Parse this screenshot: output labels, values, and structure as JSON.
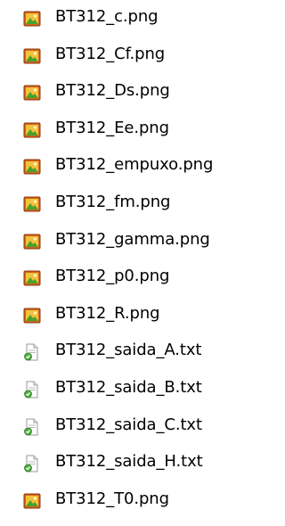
{
  "files": [
    {
      "name": "BT312_c.png",
      "icon": "png-image-icon"
    },
    {
      "name": "BT312_Cf.png",
      "icon": "png-image-icon"
    },
    {
      "name": "BT312_Ds.png",
      "icon": "png-image-icon"
    },
    {
      "name": "BT312_Ee.png",
      "icon": "png-image-icon"
    },
    {
      "name": "BT312_empuxo.png",
      "icon": "png-image-icon"
    },
    {
      "name": "BT312_fm.png",
      "icon": "png-image-icon"
    },
    {
      "name": "BT312_gamma.png",
      "icon": "png-image-icon"
    },
    {
      "name": "BT312_p0.png",
      "icon": "png-image-icon"
    },
    {
      "name": "BT312_R.png",
      "icon": "png-image-icon"
    },
    {
      "name": "BT312_saida_A.txt",
      "icon": "txt-file-icon"
    },
    {
      "name": "BT312_saida_B.txt",
      "icon": "txt-file-icon"
    },
    {
      "name": "BT312_saida_C.txt",
      "icon": "txt-file-icon"
    },
    {
      "name": "BT312_saida_H.txt",
      "icon": "txt-file-icon"
    },
    {
      "name": "BT312_T0.png",
      "icon": "png-image-icon"
    }
  ],
  "colors": {
    "text": "#000000",
    "png_icon_body": "#d4641e",
    "png_icon_accent": "#f2c23a",
    "png_icon_leaf": "#4aa02c",
    "txt_icon_paper": "#ffffff",
    "txt_icon_border": "#9a9a9a",
    "txt_icon_badge": "#4caf3e"
  }
}
